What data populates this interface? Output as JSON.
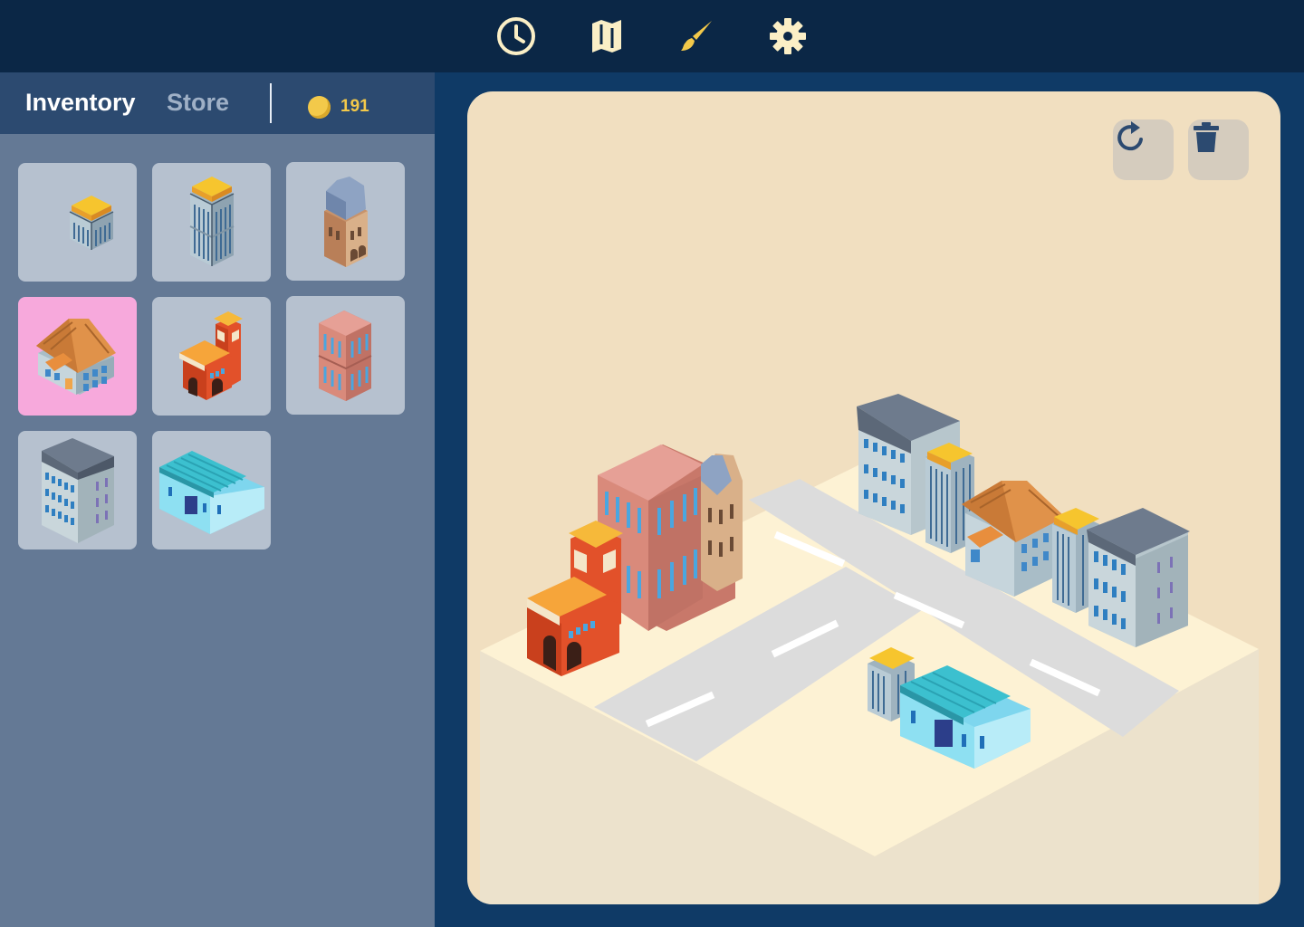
{
  "toolbar": {
    "tools": [
      {
        "name": "history",
        "icon": "clock-icon"
      },
      {
        "name": "map",
        "icon": "map-icon"
      },
      {
        "name": "paint",
        "icon": "paintbrush-icon"
      },
      {
        "name": "settings",
        "icon": "gear-icon"
      }
    ]
  },
  "sidebar": {
    "tabs": [
      {
        "label": "Inventory",
        "active": true
      },
      {
        "label": "Store",
        "active": false
      }
    ],
    "coins": "191",
    "inventory": [
      {
        "item": "small-glass-tower",
        "selected": false
      },
      {
        "item": "tall-glass-tower",
        "selected": false
      },
      {
        "item": "brick-townhouse",
        "selected": false
      },
      {
        "item": "wooden-roof-house",
        "selected": true
      },
      {
        "item": "fire-station",
        "selected": false
      },
      {
        "item": "pink-office-block",
        "selected": false
      },
      {
        "item": "grey-apartment",
        "selected": false
      },
      {
        "item": "warehouse",
        "selected": false
      }
    ]
  },
  "board": {
    "actions": [
      {
        "name": "rotate",
        "icon": "rotate-icon"
      },
      {
        "name": "delete",
        "icon": "trash-icon"
      }
    ]
  },
  "colors": {
    "topbar": "#0b2746",
    "sidebar": "#647995",
    "sidebar_header": "#2c4a70",
    "slot": "#b6c1cf",
    "slot_selected": "#f7a9dc",
    "board": "#f1dfc0",
    "icon": "#fbefc6",
    "paintbrush": "#f3c94a",
    "coin": "#f3c94a"
  }
}
